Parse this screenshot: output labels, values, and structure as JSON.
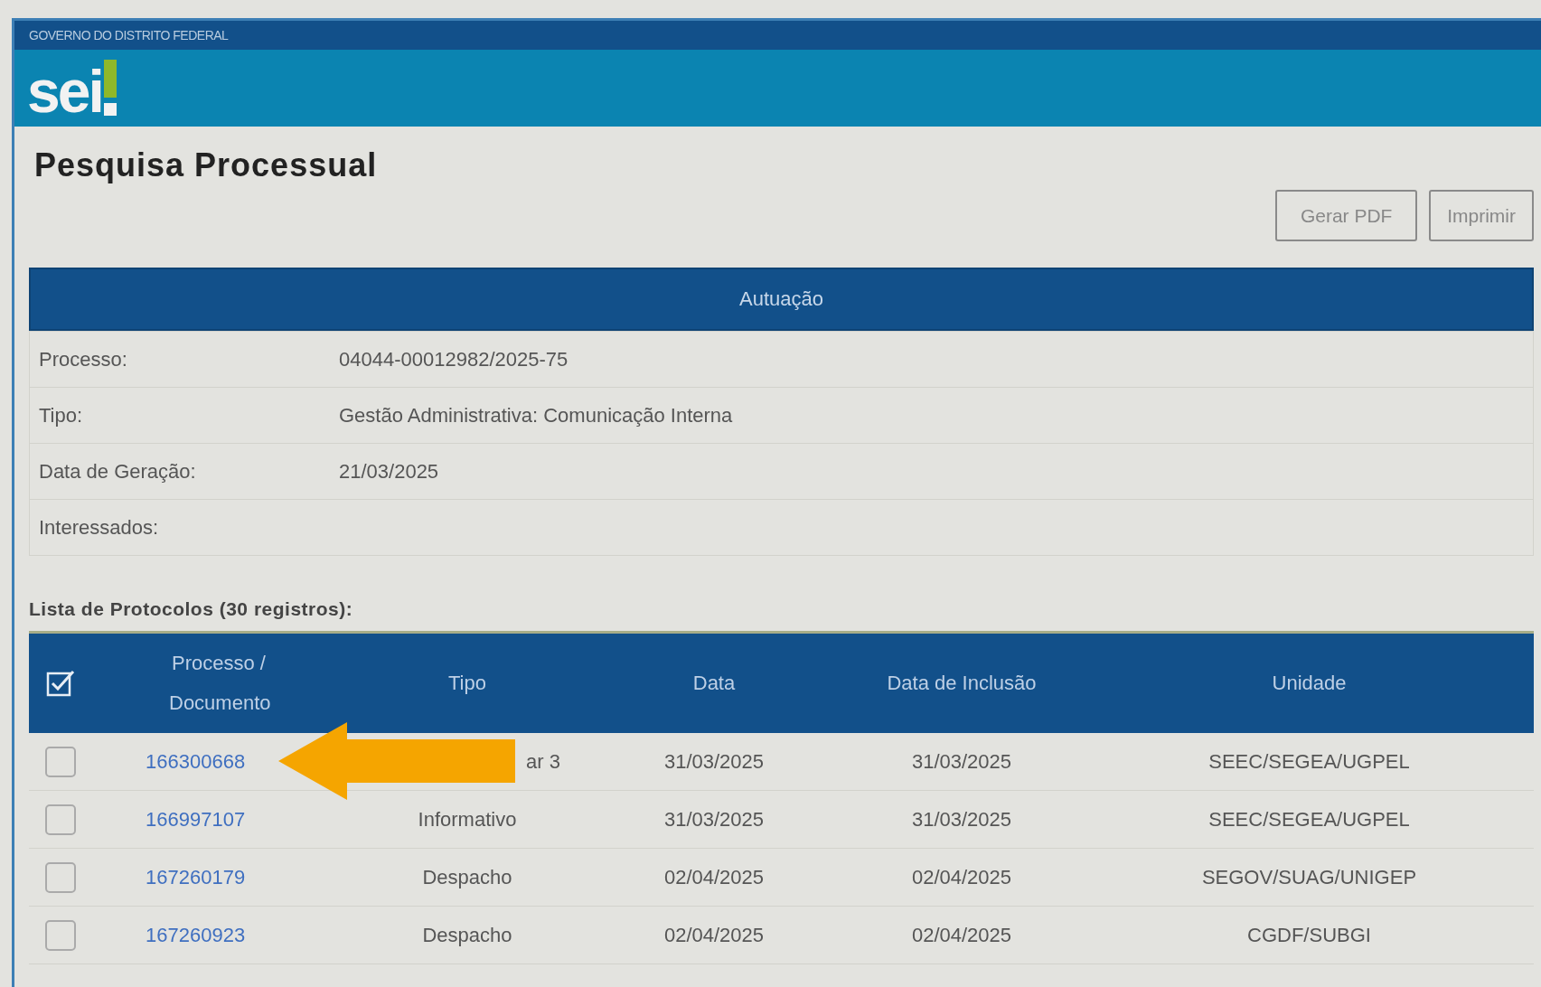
{
  "header": {
    "government": "GOVERNO DO DISTRITO FEDERAL",
    "logo": "sei"
  },
  "title": "Pesquisa Processual",
  "buttons": [
    {
      "label": "Gerar PDF"
    },
    {
      "label": "Imprimir"
    }
  ],
  "autuacao": {
    "heading": "Autuação",
    "fields": [
      {
        "label": "Processo:",
        "value": "04044-00012982/2025-75"
      },
      {
        "label": "Tipo:",
        "value": "Gestão Administrativa: Comunicação Interna"
      },
      {
        "label": "Data de Geração:",
        "value": "21/03/2025"
      },
      {
        "label": "Interessados:"
      }
    ]
  },
  "protocols": {
    "caption": "Lista de Protocolos (30 registros):",
    "columns": [
      "Processo / Documento",
      "Tipo",
      "Data",
      "Data de Inclusão",
      "Unidade"
    ],
    "rows": [
      {
        "checked": false,
        "document": "166300668",
        "tipo": "ar 3",
        "data": "31/03/2025",
        "inclusao": "31/03/2025",
        "unidade": "SEEC/SEGEA/UGPEL",
        "pointer": true
      },
      {
        "checked": false,
        "document": "166997107",
        "tipo": "Informativo",
        "data": "31/03/2025",
        "inclusao": "31/03/2025",
        "unidade": "SEEC/SEGEA/UGPEL",
        "pointer": false
      },
      {
        "checked": false,
        "document": "167260179",
        "tipo": "Despacho",
        "data": "02/04/2025",
        "inclusao": "02/04/2025",
        "unidade": "SEGOV/SUAG/UNIGEP",
        "pointer": false
      },
      {
        "checked": false,
        "document": "167260923",
        "tipo": "Despacho",
        "data": "02/04/2025",
        "inclusao": "02/04/2025",
        "unidade": "CGDF/SUBGI",
        "pointer": false
      }
    ]
  }
}
